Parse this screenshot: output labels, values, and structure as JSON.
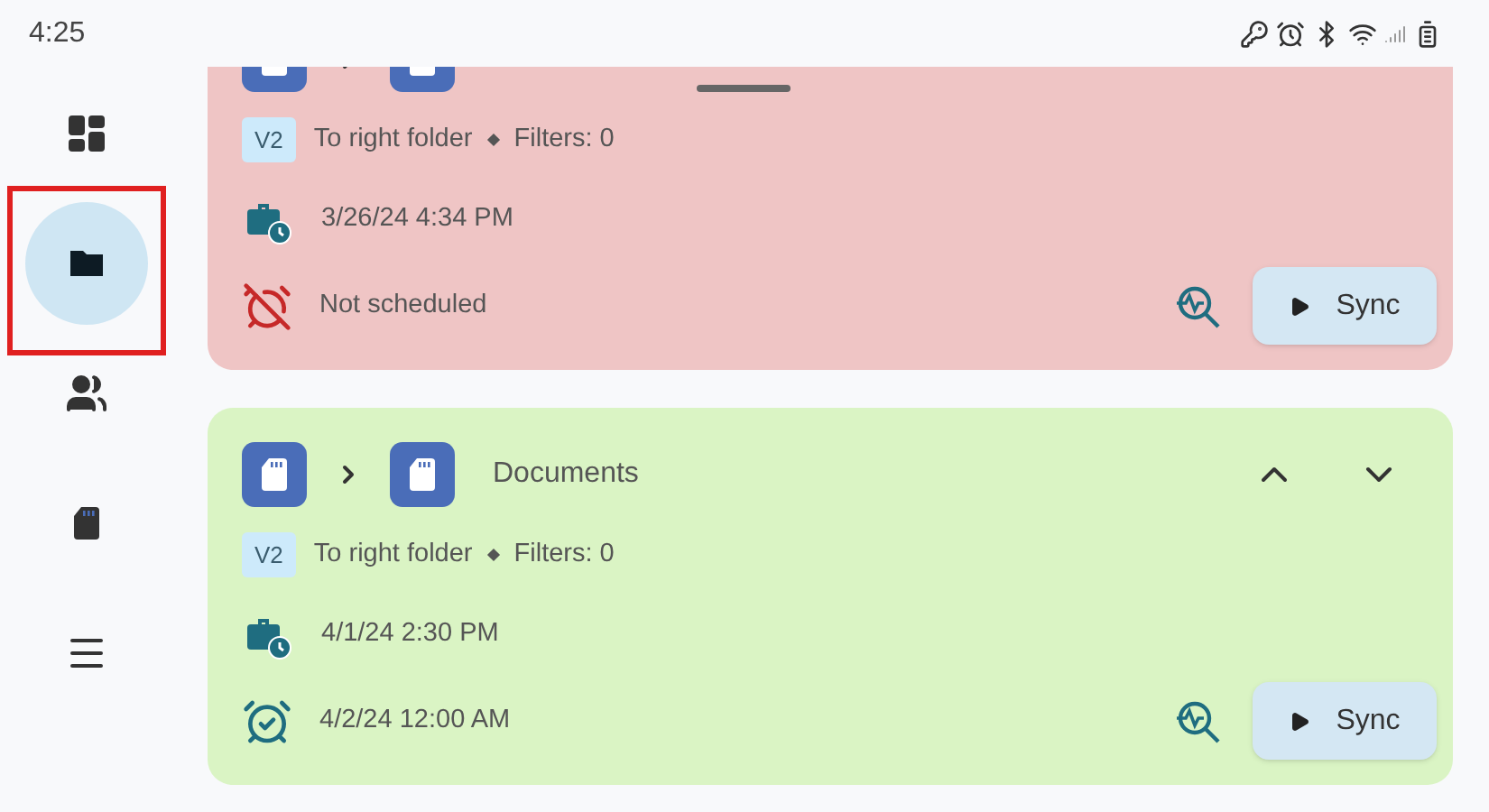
{
  "status_bar": {
    "time": "4:25"
  },
  "nav": {
    "items": [
      {
        "kind": "dashboard",
        "selected": false
      },
      {
        "kind": "folder",
        "selected": true
      },
      {
        "kind": "people",
        "selected": false
      },
      {
        "kind": "sdcard",
        "selected": false
      },
      {
        "kind": "menu",
        "selected": false
      }
    ]
  },
  "cards": [
    {
      "color": "#efc5c5",
      "version": "V2",
      "description": "To right folder",
      "filters": "Filters: 0",
      "last_sync": "3/26/24 4:34 PM",
      "schedule": "Not scheduled",
      "scheduled": false,
      "sync_label": "Sync"
    },
    {
      "color": "#daf4c4",
      "title": "Documents",
      "version": "V2",
      "description": "To right folder",
      "filters": "Filters: 0",
      "last_sync": "4/1/24 2:30 PM",
      "schedule": "4/2/24 12:00 AM",
      "scheduled": true,
      "sync_label": "Sync"
    }
  ]
}
